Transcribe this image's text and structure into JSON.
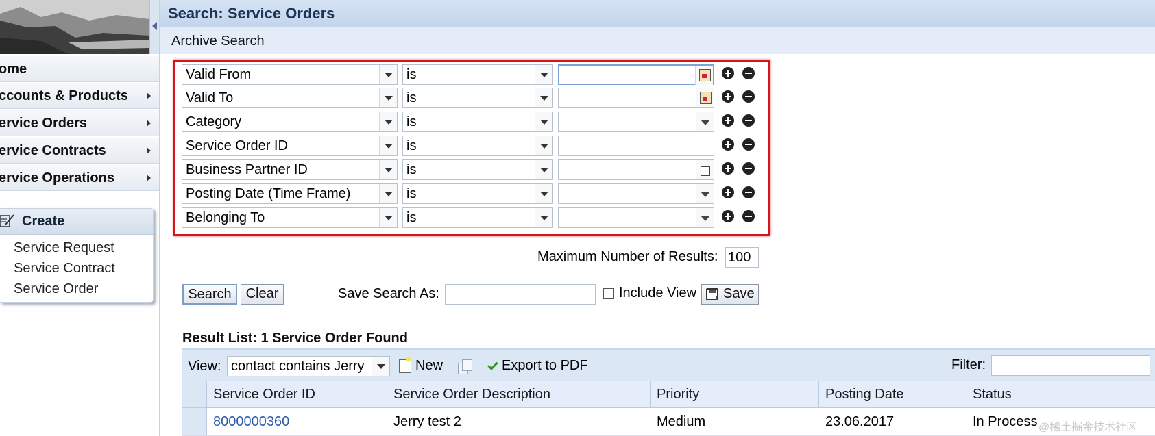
{
  "nav": {
    "items": [
      {
        "label": "ome",
        "has_submenu": false
      },
      {
        "label": "ccounts & Products",
        "has_submenu": true
      },
      {
        "label": "ervice Orders",
        "has_submenu": true
      },
      {
        "label": "ervice Contracts",
        "has_submenu": true
      },
      {
        "label": "ervice Operations",
        "has_submenu": true
      }
    ],
    "create": {
      "title": "Create",
      "links": [
        "Service Request",
        "Service Contract",
        "Service Order"
      ]
    }
  },
  "header": {
    "title": "Search: Service Orders",
    "subtitle": "Archive Search"
  },
  "criteria": [
    {
      "field": "Valid From",
      "operator": "is",
      "value": "",
      "value_control": "calendar"
    },
    {
      "field": "Valid To",
      "operator": "is",
      "value": "",
      "value_control": "calendar"
    },
    {
      "field": "Category",
      "operator": "is",
      "value": "",
      "value_control": "dropdown"
    },
    {
      "field": "Service Order ID",
      "operator": "is",
      "value": "",
      "value_control": "text"
    },
    {
      "field": "Business Partner ID",
      "operator": "is",
      "value": "",
      "value_control": "value-help"
    },
    {
      "field": "Posting Date (Time Frame)",
      "operator": "is",
      "value": "",
      "value_control": "dropdown"
    },
    {
      "field": "Belonging To",
      "operator": "is",
      "value": "",
      "value_control": "dropdown"
    }
  ],
  "max_results": {
    "label": "Maximum Number of Results:",
    "value": "100"
  },
  "actions": {
    "search_label": "Search",
    "clear_label": "Clear",
    "save_search_label": "Save Search As:",
    "save_search_value": "",
    "include_view_label": "Include View",
    "include_view_checked": false,
    "save_label": "Save"
  },
  "results": {
    "title": "Result List: 1 Service Order Found",
    "view_label": "View:",
    "view_value": "contact contains Jerry",
    "new_label": "New",
    "export_label": "Export to PDF",
    "filter_label": "Filter:",
    "filter_value": "",
    "columns": [
      "Service Order ID",
      "Service Order Description",
      "Priority",
      "Posting Date",
      "Status"
    ],
    "rows": [
      [
        "8000000360",
        "Jerry test 2",
        "Medium",
        "23.06.2017",
        "In Process"
      ]
    ]
  },
  "watermark": "@稀土掘金技术社区",
  "colors": {
    "highlight_border": "#d4161c",
    "header_bg": "#c3d5ec",
    "link": "#2b5ea8"
  }
}
